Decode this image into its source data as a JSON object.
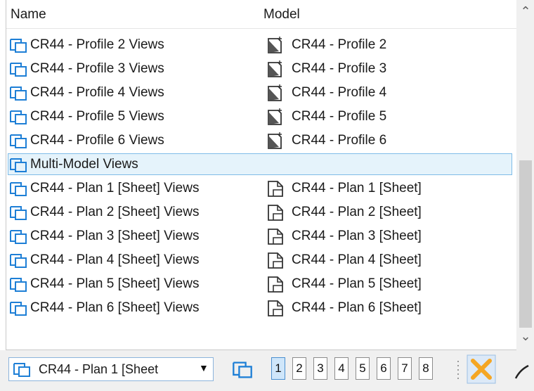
{
  "header": {
    "name": "Name",
    "model": "Model"
  },
  "rows": [
    {
      "name": "CR44 - Profile 2 Views",
      "model": "CR44 - Profile 2",
      "model_icon": "profile-model-icon"
    },
    {
      "name": "CR44 - Profile 3 Views",
      "model": "CR44 - Profile 3",
      "model_icon": "profile-model-icon"
    },
    {
      "name": "CR44 - Profile 4 Views",
      "model": "CR44 - Profile 4",
      "model_icon": "profile-model-icon"
    },
    {
      "name": "CR44 - Profile 5 Views",
      "model": "CR44 - Profile 5",
      "model_icon": "profile-model-icon"
    },
    {
      "name": "CR44 - Profile 6 Views",
      "model": "CR44 - Profile 6",
      "model_icon": "profile-model-icon"
    },
    {
      "name": "Multi-Model Views",
      "model": "",
      "selected": true
    },
    {
      "name": "CR44 - Plan 1 [Sheet] Views",
      "model": "CR44 - Plan 1 [Sheet]",
      "model_icon": "sheet-model-icon"
    },
    {
      "name": "CR44 - Plan 2 [Sheet] Views",
      "model": "CR44 - Plan 2 [Sheet]",
      "model_icon": "sheet-model-icon"
    },
    {
      "name": "CR44 - Plan 3 [Sheet] Views",
      "model": "CR44 - Plan 3 [Sheet]",
      "model_icon": "sheet-model-icon"
    },
    {
      "name": "CR44 - Plan 4 [Sheet] Views",
      "model": "CR44 - Plan 4 [Sheet]",
      "model_icon": "sheet-model-icon"
    },
    {
      "name": "CR44 - Plan 5 [Sheet] Views",
      "model": "CR44 - Plan 5 [Sheet]",
      "model_icon": "sheet-model-icon"
    },
    {
      "name": "CR44 - Plan 6 [Sheet] Views",
      "model": "CR44 - Plan 6 [Sheet]",
      "model_icon": "sheet-model-icon"
    }
  ],
  "toolbar": {
    "view_select": "CR44 - Plan 1 [Sheet",
    "tabs": [
      "1",
      "2",
      "3",
      "4",
      "5",
      "6",
      "7",
      "8"
    ],
    "active_tab": "1"
  },
  "colors": {
    "view_icon": "#1e7fd6",
    "selection_bg": "#e5f3fb",
    "selection_border": "#7fbce8",
    "close_icon": "#f5a623"
  }
}
